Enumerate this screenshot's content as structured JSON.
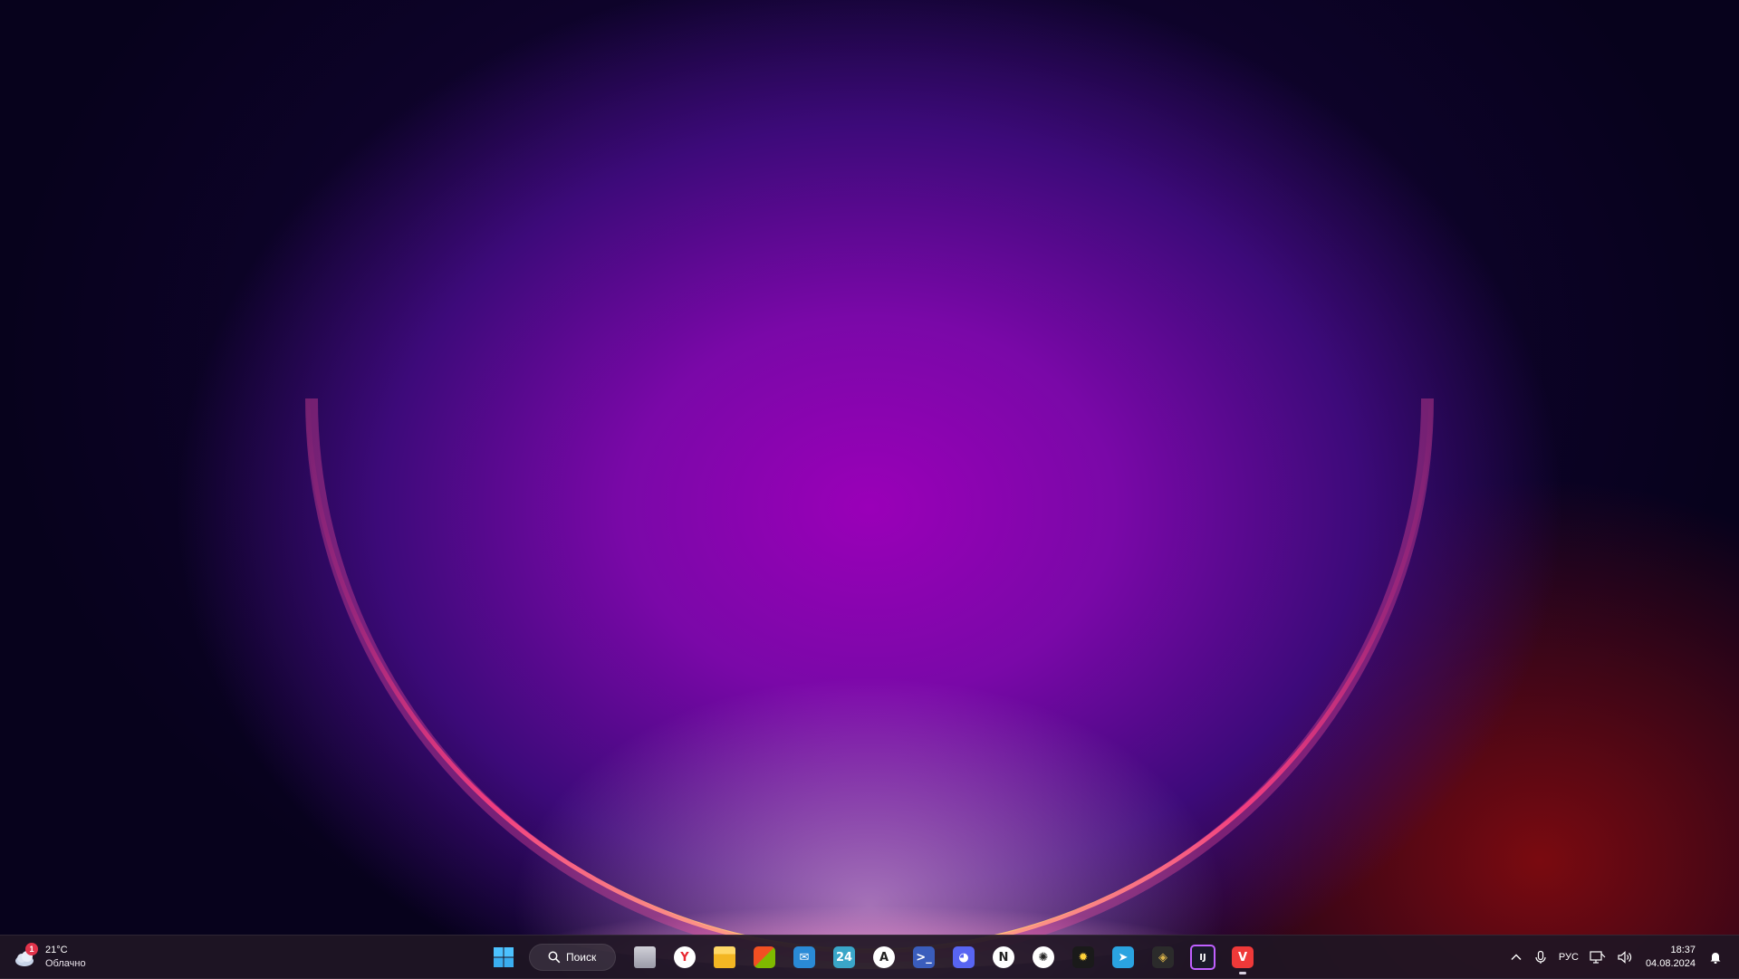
{
  "weather": {
    "temperature": "21°C",
    "condition": "Облачно",
    "badge": "1",
    "icon": "cloud-icon"
  },
  "taskbar": {
    "start_icon": "windows-start-icon",
    "search": {
      "label": "Поиск",
      "icon": "search-icon"
    },
    "apps": [
      {
        "name": "task-view",
        "icon": "task-view-icon",
        "glyph": "",
        "color": "#9a9aa8"
      },
      {
        "name": "yandex-browser",
        "icon": "yandex-browser-icon",
        "glyph": "Y",
        "color": "#ffffff"
      },
      {
        "name": "file-explorer",
        "icon": "folder-icon",
        "glyph": "",
        "color": "#f6c445"
      },
      {
        "name": "microsoft-store",
        "icon": "store-icon",
        "glyph": "",
        "color": "#ffffff"
      },
      {
        "name": "mail",
        "icon": "mail-icon",
        "glyph": "✉",
        "color": "#2a8ad6"
      },
      {
        "name": "24-app",
        "icon": "24-icon",
        "glyph": "24",
        "color": "#3aa6c8"
      },
      {
        "name": "app-a",
        "icon": "a-app-icon",
        "glyph": "A",
        "color": "#ffffff"
      },
      {
        "name": "powershell",
        "icon": "powershell-icon",
        "glyph": ">_",
        "color": "#3a5dbc"
      },
      {
        "name": "discord",
        "icon": "discord-icon",
        "glyph": "◕",
        "color": "#5865f2"
      },
      {
        "name": "notion",
        "icon": "notion-icon",
        "glyph": "N",
        "color": "#ffffff"
      },
      {
        "name": "chatgpt",
        "icon": "chatgpt-icon",
        "glyph": "✺",
        "color": "#ffffff"
      },
      {
        "name": "sun-app",
        "icon": "sun-icon",
        "glyph": "✹",
        "color": "#1a1a1a"
      },
      {
        "name": "telegram",
        "icon": "telegram-icon",
        "glyph": "➤",
        "color": "#2aa3e0"
      },
      {
        "name": "shield-app",
        "icon": "shield-icon",
        "glyph": "◈",
        "color": "#2b2b2b"
      },
      {
        "name": "jetbrains-ide",
        "icon": "jetbrains-icon",
        "glyph": "IJ",
        "color": "#1a1a2a"
      },
      {
        "name": "vivaldi",
        "icon": "vivaldi-icon",
        "glyph": "V",
        "color": "#ef3939",
        "active": true
      }
    ]
  },
  "tray": {
    "chevron_icon": "chevron-up-icon",
    "mic_icon": "microphone-icon",
    "language": "РУС",
    "network_icon": "network-icon",
    "volume_icon": "volume-icon",
    "time": "18:37",
    "date": "04.08.2024",
    "notification_icon": "notification-bell-icon"
  }
}
